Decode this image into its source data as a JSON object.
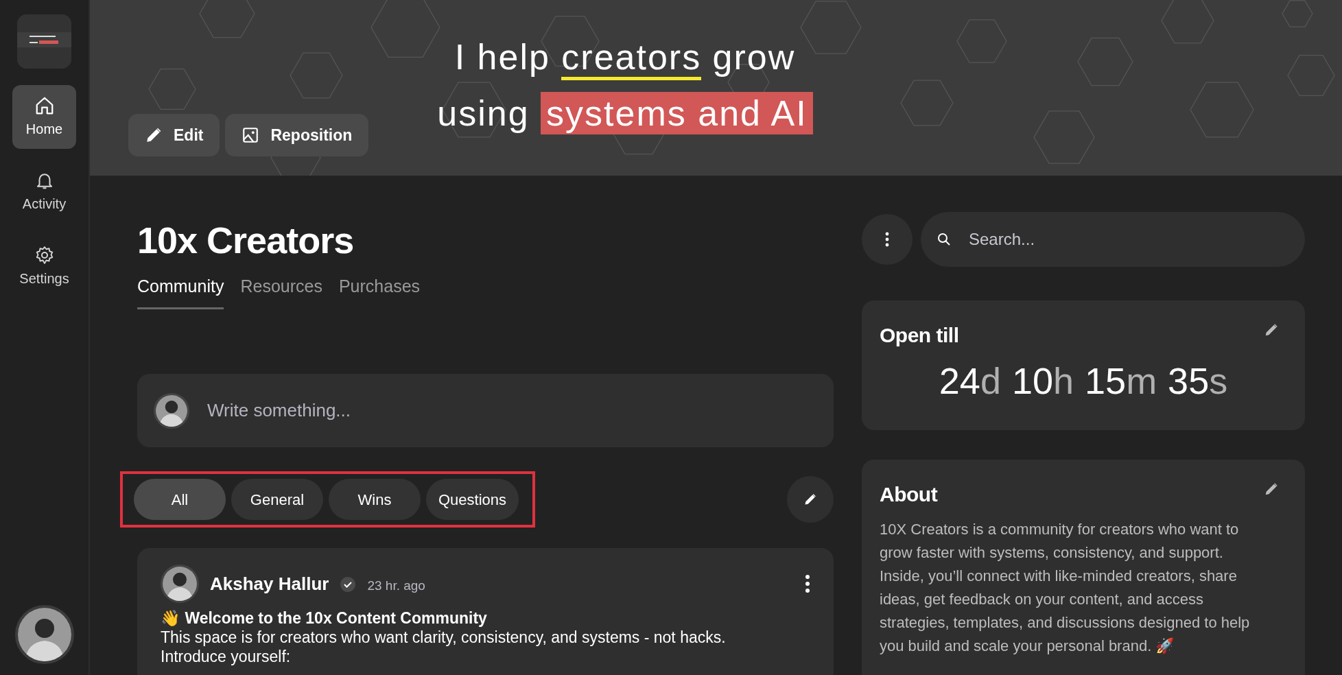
{
  "sidebar": {
    "items": [
      {
        "label": "Home",
        "selected": true
      },
      {
        "label": "Activity",
        "selected": false
      },
      {
        "label": "Settings",
        "selected": false
      }
    ]
  },
  "banner": {
    "line_1": {
      "before": "I help ",
      "highlight": "creators",
      "after": " grow"
    },
    "line_2": {
      "before": "using ",
      "highlight": "systems and AI"
    },
    "buttons": [
      {
        "label": "Edit"
      },
      {
        "label": "Reposition"
      }
    ]
  },
  "community": {
    "title": "10x Creators",
    "tabs": [
      {
        "label": "Community",
        "selected": true
      },
      {
        "label": "Resources",
        "selected": false
      },
      {
        "label": "Purchases",
        "selected": false
      }
    ]
  },
  "composer": {
    "placeholder": "Write something..."
  },
  "filters": [
    {
      "label": "All",
      "selected": true
    },
    {
      "label": "General",
      "selected": false
    },
    {
      "label": "Wins",
      "selected": false
    },
    {
      "label": "Questions",
      "selected": false
    }
  ],
  "post": {
    "author": "Akshay Hallur",
    "verified": true,
    "time": "23 hr. ago",
    "title": "👋 Welcome to the 10x Content Community",
    "body": "This space is for creators who want clarity, consistency, and systems - not hacks.",
    "body_2": "Introduce yourself:"
  },
  "search": {
    "placeholder": "Search..."
  },
  "open_till": {
    "title": "Open till",
    "countdown": [
      {
        "value": "24",
        "unit": "d"
      },
      {
        "value": "10",
        "unit": "h"
      },
      {
        "value": "15",
        "unit": "m"
      },
      {
        "value": "35",
        "unit": "s"
      }
    ]
  },
  "about": {
    "title": "About",
    "text": "10X Creators is a community for creators who want to grow faster with systems, consistency, and support. Inside, you’ll connect with like-minded creators, share ideas, get feedback on your content, and access strategies, templates, and discussions designed to help you build and scale your personal brand. 🚀"
  }
}
